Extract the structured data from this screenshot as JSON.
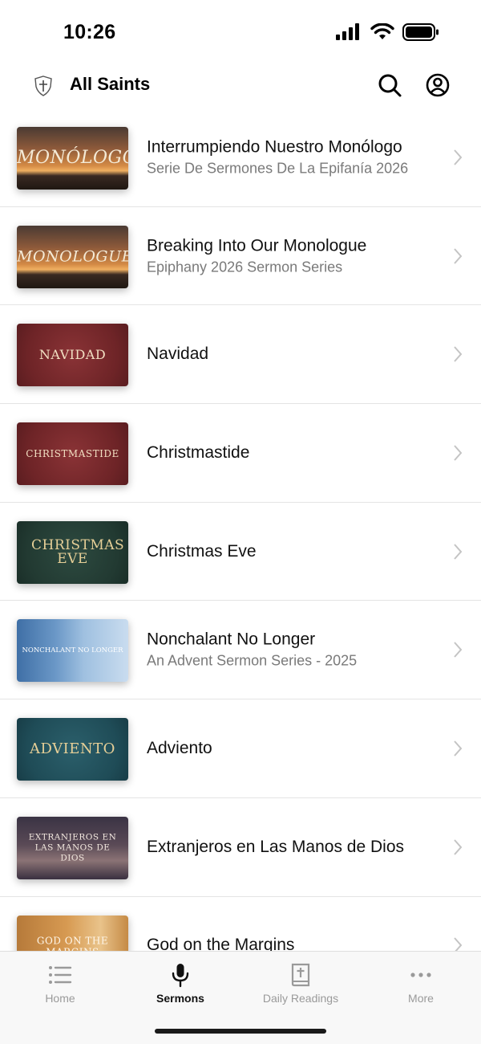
{
  "status": {
    "time": "10:26"
  },
  "header": {
    "title": "All Saints",
    "logo_icon": "shield-cross-icon"
  },
  "sermons": [
    {
      "title": "Interrumpiendo Nuestro Monólogo",
      "subtitle": "Serie De Sermones De La Epifanía 2026",
      "thumb_text": "MONÓLOGO"
    },
    {
      "title": "Breaking Into Our Monologue",
      "subtitle": "Epiphany 2026 Sermon Series",
      "thumb_text": "MONOLOGUE"
    },
    {
      "title": "Navidad",
      "subtitle": "",
      "thumb_text": "NAVIDAD"
    },
    {
      "title": "Christmastide",
      "subtitle": "",
      "thumb_text": "CHRISTMASTIDE"
    },
    {
      "title": "Christmas Eve",
      "subtitle": "",
      "thumb_text": "CHRISTMAS EVE"
    },
    {
      "title": "Nonchalant No Longer",
      "subtitle": "An Advent Sermon Series - 2025",
      "thumb_text": "NONCHALANT NO LONGER"
    },
    {
      "title": "Adviento",
      "subtitle": "",
      "thumb_text": "ADVIENTO"
    },
    {
      "title": "Extranjeros en Las Manos de Dios",
      "subtitle": "",
      "thumb_text": "EXTRANJEROS EN LAS MANOS DE DIOS"
    },
    {
      "title": "God on the Margins",
      "subtitle": "",
      "thumb_text": "GOD ON THE MARGINS"
    }
  ],
  "tabs": [
    {
      "label": "Home",
      "icon": "list-icon"
    },
    {
      "label": "Sermons",
      "icon": "microphone-icon"
    },
    {
      "label": "Daily Readings",
      "icon": "bible-icon"
    },
    {
      "label": "More",
      "icon": "ellipsis-icon"
    }
  ],
  "active_tab": "Sermons"
}
